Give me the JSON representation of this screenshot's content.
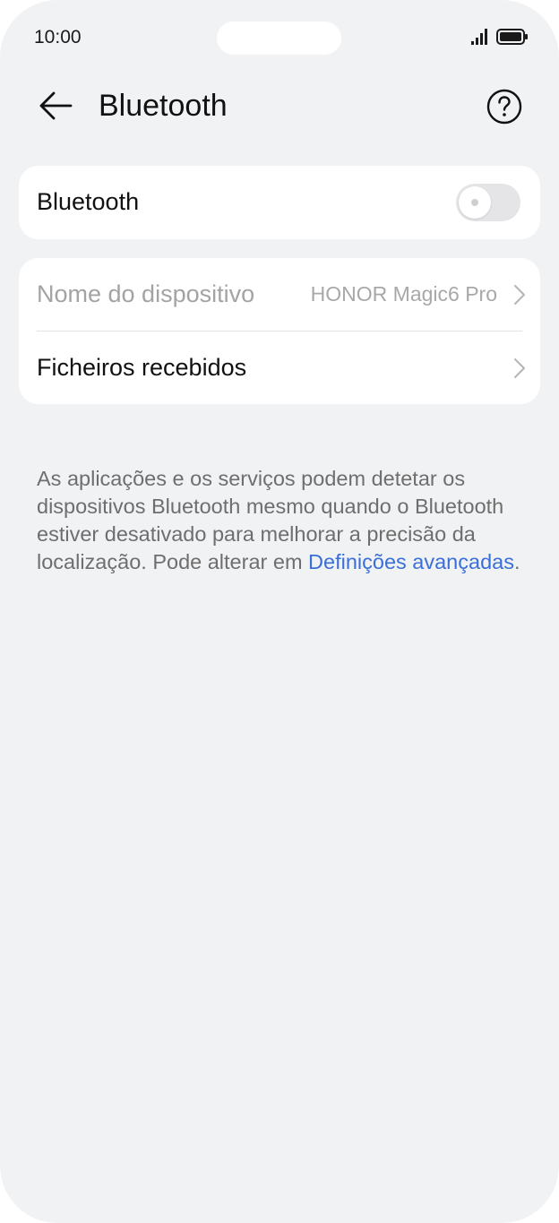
{
  "status_bar": {
    "time": "10:00",
    "icons": [
      "signal-icon",
      "battery-icon"
    ]
  },
  "app_bar": {
    "title": "Bluetooth",
    "back_icon": "arrow-left-icon",
    "help_icon": "help-circle-icon"
  },
  "bluetooth_card": {
    "label": "Bluetooth",
    "toggle_on": false
  },
  "device_card": {
    "device_name_label": "Nome do dispositivo",
    "device_name_value": "HONOR Magic6 Pro",
    "received_files_label": "Ficheiros recebidos"
  },
  "info": {
    "text": "As aplicações e os serviços podem detetar os dispositivos Bluetooth mesmo quando o Bluetooth estiver desativado para melhorar a precisão da localização. Pode alterar em ",
    "link": "Definições avançadas",
    "suffix": "."
  },
  "colors": {
    "background": "#f1f2f4",
    "card": "#ffffff",
    "link": "#3a6fd8",
    "toggle_off": "#e5e5e7"
  }
}
